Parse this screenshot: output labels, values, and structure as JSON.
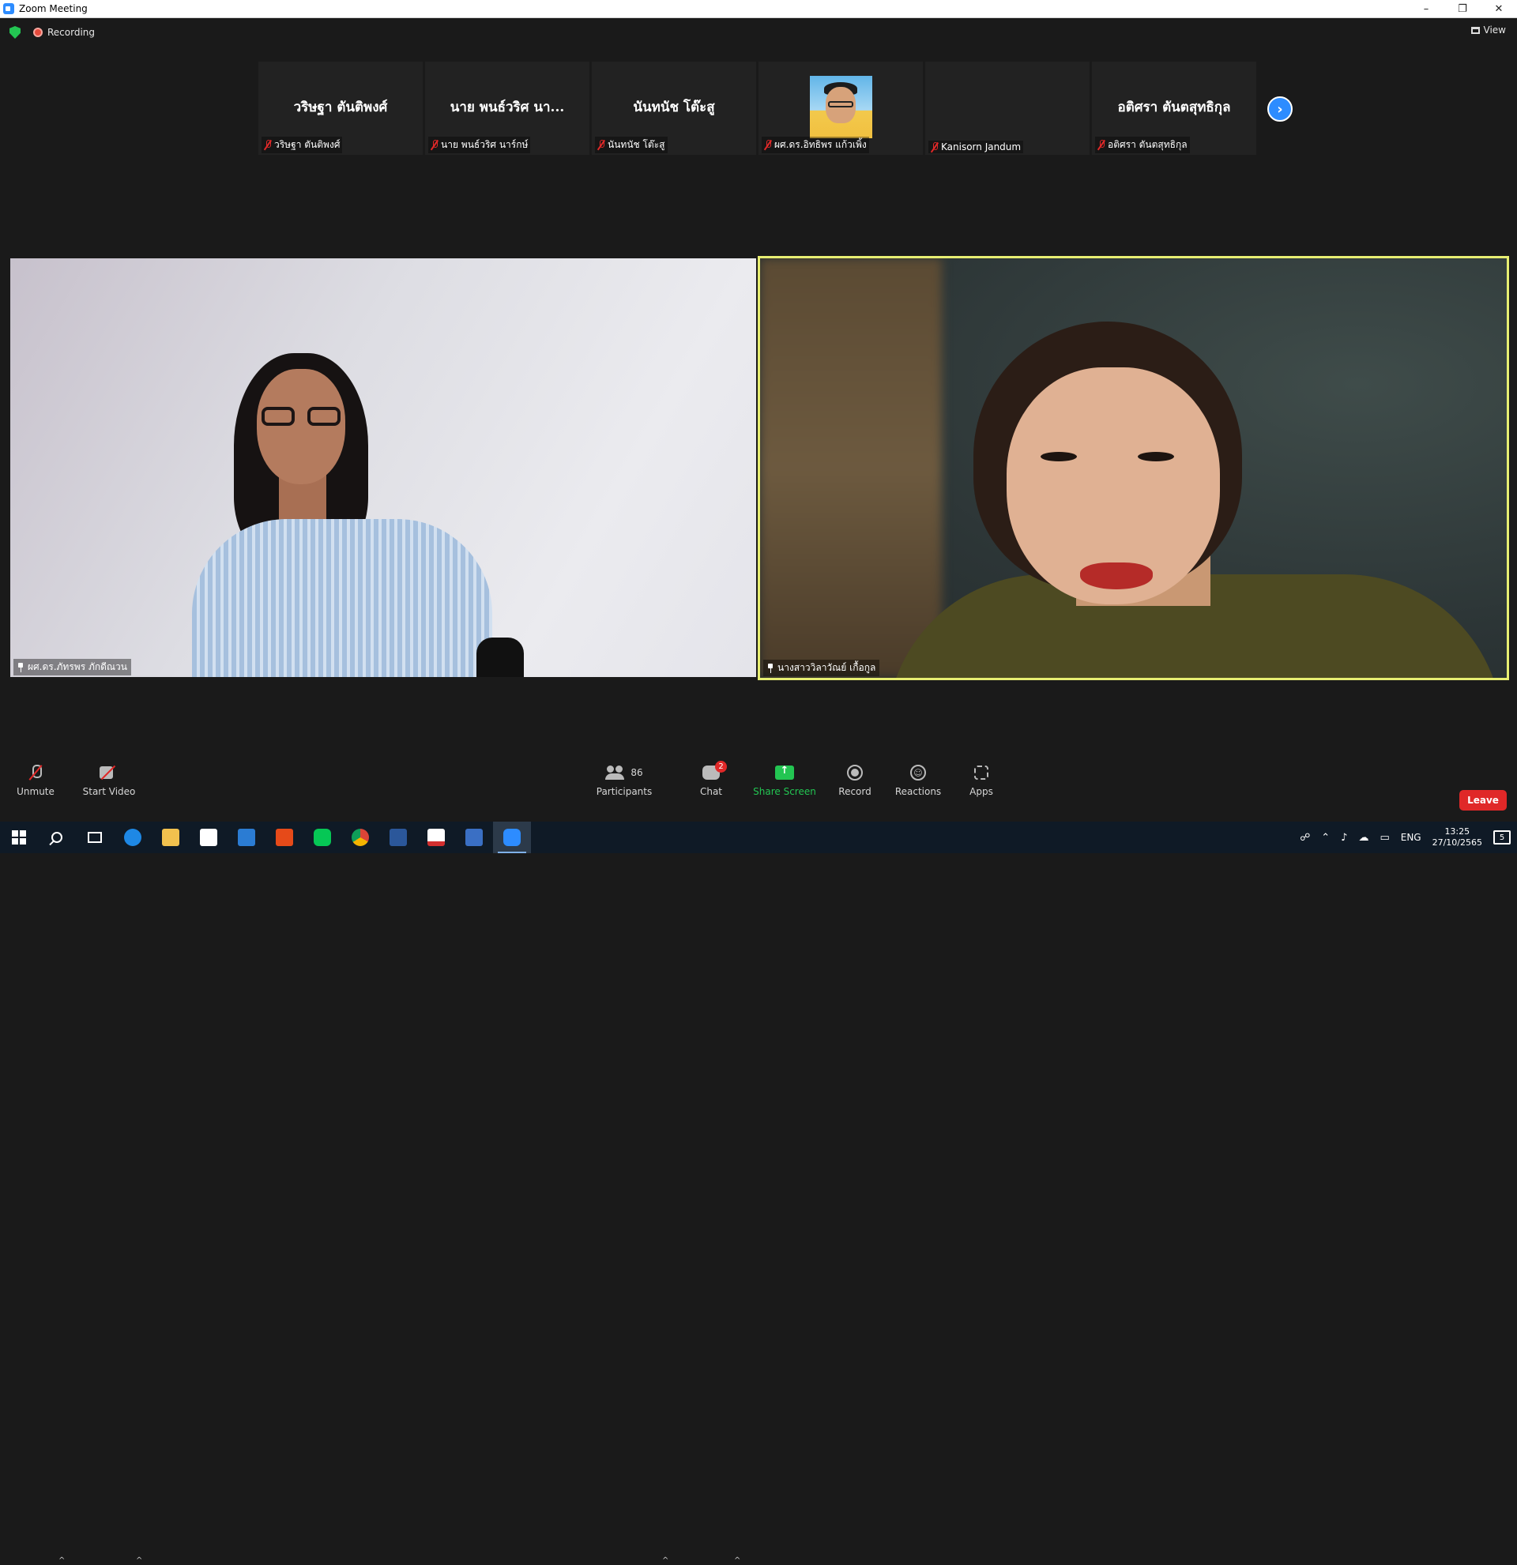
{
  "window": {
    "title": "Zoom Meeting",
    "controls": [
      "–",
      "❐",
      "✕"
    ]
  },
  "status": {
    "recording_label": "Recording",
    "view_label": "View"
  },
  "strip": {
    "tiles": [
      {
        "display_name": "วริษฐา ตันติพงศ์",
        "label": "วริษฐา ตันติพงศ์"
      },
      {
        "display_name": "นาย พนธ์วริศ นา...",
        "label": "นาย พนธ์วริศ นาร์กษ์"
      },
      {
        "display_name": "นันทนัช โต๊ะสู",
        "label": "นันทนัช โต๊ะสู"
      },
      {
        "display_name": "",
        "label": "ผศ.ดร.อิทธิพร แก้วเพิ้ง"
      },
      {
        "display_name": "",
        "label": "Kanisorn  Jandum"
      },
      {
        "display_name": "อติศรา ตันตสุทธิกุล",
        "label": "อติศรา ตันตสุทธิกุล"
      }
    ],
    "next_icon": "chevron-right-icon"
  },
  "videos": {
    "left_name": "ผศ.ดร.ภัทรพร ภักดีณวน",
    "right_name": "นางสาววิลาวัณย์ เกื้อกูล"
  },
  "toolbar": {
    "unmute": "Unmute",
    "start_video": "Start Video",
    "participants": "Participants",
    "participants_count": "86",
    "chat": "Chat",
    "chat_badge": "2",
    "share_screen": "Share Screen",
    "record": "Record",
    "reactions": "Reactions",
    "apps": "Apps",
    "leave": "Leave",
    "caret": "^"
  },
  "taskbar": {
    "language": "ENG",
    "time": "13:25",
    "date": "27/10/2565",
    "notification_count": "5",
    "apps": [
      "start",
      "search",
      "task-view",
      "edge",
      "file-explorer",
      "store",
      "mail",
      "office",
      "line",
      "chrome",
      "word",
      "acrobat",
      "reader",
      "zoom"
    ]
  },
  "colors": {
    "active_speaker_border": "#e7ee72",
    "leave": "#e02828",
    "share": "#23c552",
    "accent": "#2d8cff"
  }
}
